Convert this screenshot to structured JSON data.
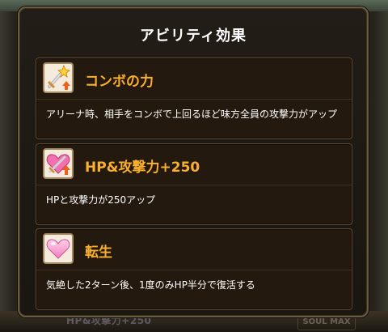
{
  "background": {
    "bottom_ghost_text": "HP&攻撃力+250",
    "soul_max_label": "SOUL MAX"
  },
  "modal": {
    "title": "アビリティ効果",
    "abilities": [
      {
        "icon": "sword-spark-up-icon",
        "name": "コンボの力",
        "description": "アリーナ時、相手をコンボで上回るほど味方全員の攻撃力がアップ"
      },
      {
        "icon": "heart-sword-up-icon",
        "name": "HP&攻撃力+250",
        "description": "HPと攻撃力が250アップ"
      },
      {
        "icon": "pink-heart-icon",
        "name": "転生",
        "description": "気絶した2ターン後、1度のみHP半分で復活する"
      }
    ]
  },
  "colors": {
    "ability_name": "#f7b030",
    "card_border": "#5e4a30",
    "modal_border": "#6b5a3e",
    "text": "#ffffff"
  }
}
